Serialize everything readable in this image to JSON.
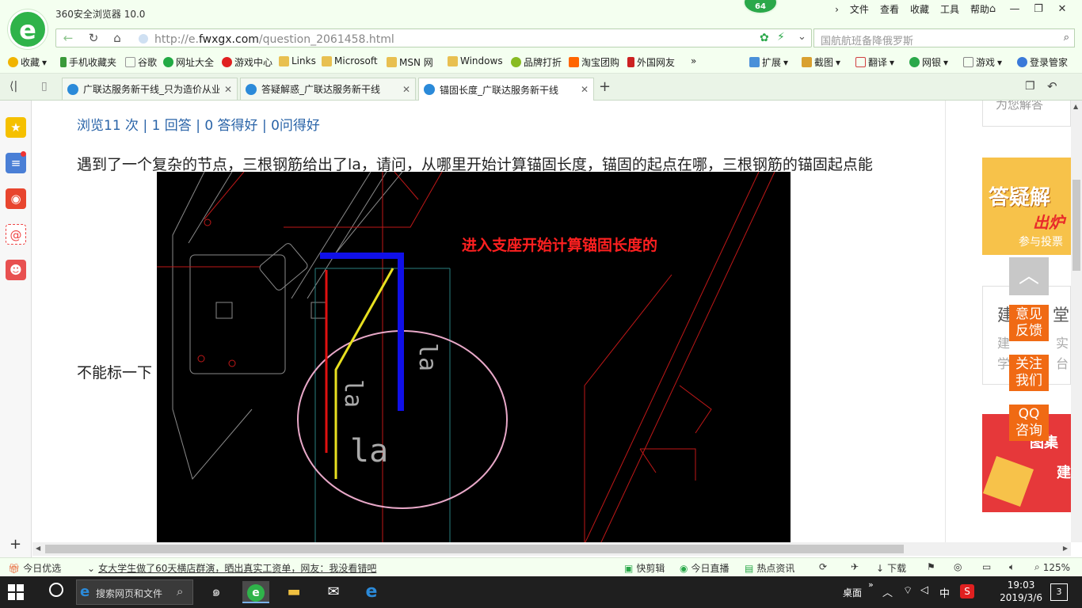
{
  "window": {
    "title": "360安全浏览器 10.0",
    "badge": "64",
    "menu": [
      "文件",
      "查看",
      "收藏",
      "工具",
      "帮助"
    ]
  },
  "address": {
    "url_prefix": "http://e.",
    "url_host": "fwxgx.com",
    "url_path": "/question_2061458.html",
    "search_placeholder": "国航航班备降俄罗斯"
  },
  "bookmarks": [
    {
      "label": "收藏",
      "color": "#f0b400"
    },
    {
      "label": "手机收藏夹",
      "color": "#3a9a3a"
    },
    {
      "label": "谷歌",
      "color": "#cccccc"
    },
    {
      "label": "网址大全",
      "color": "#22aa44"
    },
    {
      "label": "游戏中心",
      "color": "#e02020"
    },
    {
      "label": "Links",
      "color": "#e8c050"
    },
    {
      "label": "Microsoft",
      "color": "#e8c050"
    },
    {
      "label": "MSN 网",
      "color": "#e8c050"
    },
    {
      "label": "Windows",
      "color": "#e8c050"
    },
    {
      "label": "品牌打折",
      "color": "#88bb22"
    },
    {
      "label": "淘宝团购",
      "color": "#ff6600"
    },
    {
      "label": "外国网友",
      "color": "#cc2222"
    }
  ],
  "toolbar_right": [
    "扩展",
    "截图",
    "翻译",
    "网银",
    "游戏",
    "登录管家"
  ],
  "tabs": [
    {
      "label": "广联达服务新干线_只为造价从业"
    },
    {
      "label": "答疑解惑_广联达服务新干线"
    },
    {
      "label": "锚固长度_广联达服务新干线"
    }
  ],
  "page": {
    "stats": "浏览11 次 | 1 回答 | 0 答得好 | 0问得好",
    "question": "遇到了一个复杂的节点，三根钢筋给出了la，请问，从哪里开始计算锚固长度，锚固的起点在哪，三根钢筋的锚固起点能",
    "question_cont": "不能标一下",
    "cad_note": "进入支座开始计算锚固长度的",
    "cad_labels": [
      "la",
      "la",
      "la"
    ],
    "ad_texts": [
      "为您解答",
      "答疑解",
      "出炉",
      "参与投票",
      "建",
      "堂",
      "建",
      "实",
      "学",
      "台",
      "图集",
      "建"
    ],
    "float_buttons": [
      {
        "label": "意见\n反馈"
      },
      {
        "label": "关注\n我们"
      },
      {
        "label": "QQ\n咨询"
      }
    ]
  },
  "status": {
    "today": "今日优选",
    "news": "女大学生做了60天横店群演，晒出真实工资单，网友：我没看错吧",
    "items": [
      "快剪辑",
      "今日直播",
      "热点资讯"
    ],
    "download": "下载",
    "zoom": "125%"
  },
  "taskbar": {
    "search_placeholder": "搜索网页和文件",
    "desktop": "桌面",
    "ime": "中",
    "time": "19:03",
    "date": "2019/3/6",
    "notifications": "3"
  }
}
